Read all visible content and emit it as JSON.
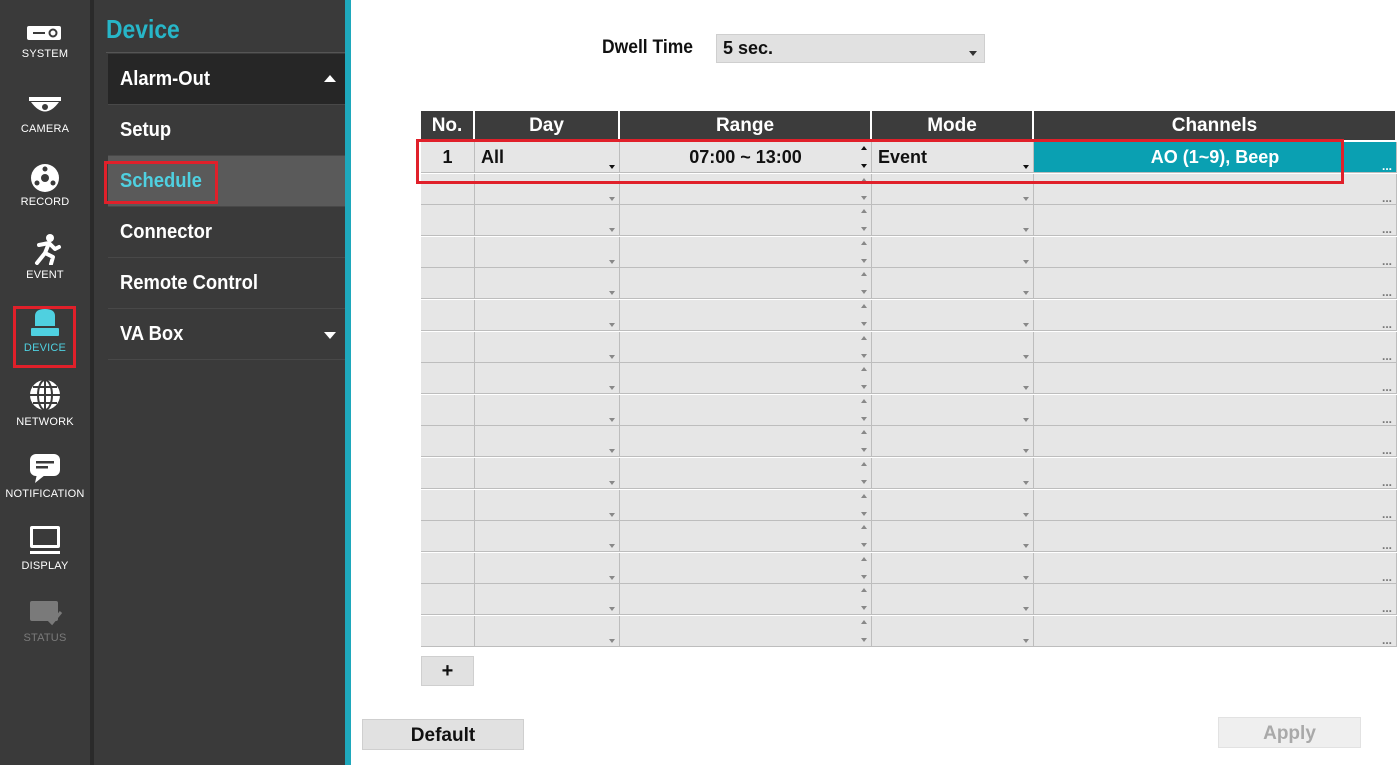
{
  "rail": {
    "items": [
      {
        "label": "SYSTEM",
        "icon": "system-icon"
      },
      {
        "label": "CAMERA",
        "icon": "camera-icon"
      },
      {
        "label": "RECORD",
        "icon": "record-icon"
      },
      {
        "label": "EVENT",
        "icon": "event-icon"
      },
      {
        "label": "DEVICE",
        "icon": "device-icon",
        "active": true
      },
      {
        "label": "NETWORK",
        "icon": "network-icon"
      },
      {
        "label": "NOTIFICATION",
        "icon": "notification-icon"
      },
      {
        "label": "DISPLAY",
        "icon": "display-icon"
      },
      {
        "label": "STATUS",
        "icon": "status-icon",
        "disabled": true
      }
    ]
  },
  "submenu": {
    "title": "Device",
    "items": [
      {
        "label": "Alarm-Out",
        "type": "group-expanded"
      },
      {
        "label": "Setup"
      },
      {
        "label": "Schedule",
        "selected": true
      },
      {
        "label": "Connector"
      },
      {
        "label": "Remote Control"
      },
      {
        "label": "VA Box",
        "type": "group-collapsed"
      }
    ]
  },
  "dwell": {
    "label": "Dwell Time",
    "value": "5 sec."
  },
  "table": {
    "headers": [
      "No.",
      "Day",
      "Range",
      "Mode",
      "Channels"
    ],
    "rows": [
      {
        "no": "1",
        "day": "All",
        "range": "07:00 ~ 13:00",
        "mode": "Event",
        "channels": "AO (1~9), Beep"
      }
    ],
    "empty_rows": 15
  },
  "buttons": {
    "add": "+",
    "default": "Default",
    "apply": "Apply"
  },
  "colors": {
    "accent": "#1ea8bc",
    "highlight": "#e0202a",
    "channels_cell": "#0aa0b2"
  }
}
